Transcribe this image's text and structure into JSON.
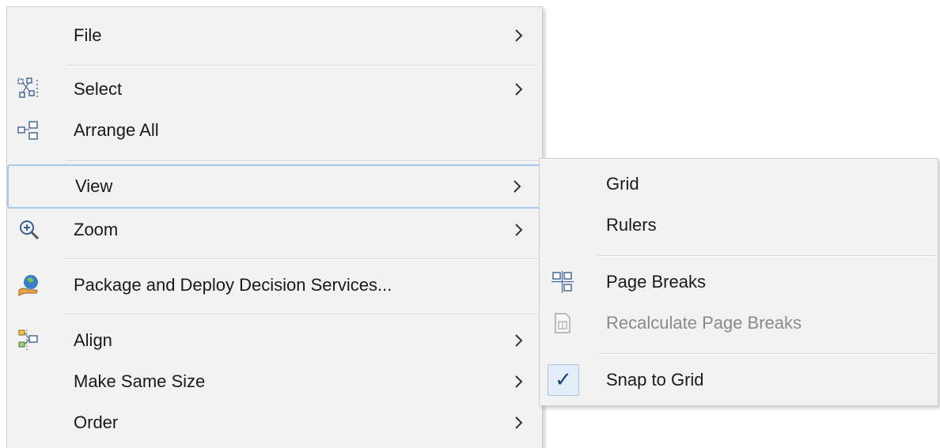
{
  "main_menu": {
    "items": [
      {
        "label": "File",
        "has_submenu": true
      },
      {
        "label": "Select",
        "has_submenu": true,
        "icon": "select-nodes-icon"
      },
      {
        "label": "Arrange All",
        "has_submenu": false,
        "icon": "arrange-all-icon"
      },
      {
        "label": "View",
        "has_submenu": true,
        "highlighted": true
      },
      {
        "label": "Zoom",
        "has_submenu": true,
        "icon": "zoom-in-icon"
      },
      {
        "label": "Package and Deploy Decision Services...",
        "has_submenu": false,
        "icon": "deploy-icon"
      },
      {
        "label": "Align",
        "has_submenu": true,
        "icon": "align-icon"
      },
      {
        "label": "Make Same Size",
        "has_submenu": true
      },
      {
        "label": "Order",
        "has_submenu": true
      }
    ]
  },
  "view_submenu": {
    "items": [
      {
        "label": "Grid",
        "enabled": true
      },
      {
        "label": "Rulers",
        "enabled": true
      },
      {
        "label": "Page Breaks",
        "enabled": true,
        "icon": "page-breaks-icon"
      },
      {
        "label": "Recalculate Page Breaks",
        "enabled": false,
        "icon": "recalculate-page-breaks-icon"
      },
      {
        "label": "Snap to Grid",
        "enabled": true,
        "checked": true,
        "check_glyph": "✓"
      }
    ]
  },
  "colors": {
    "menu_background": "#f2f2f2",
    "hover_border": "#a9c7ea",
    "check_background": "#e4eefa",
    "disabled_text": "#8a8a8a"
  }
}
